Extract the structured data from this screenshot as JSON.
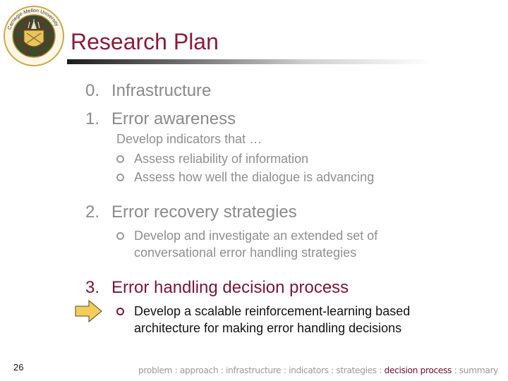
{
  "slide": {
    "title": "Research Plan",
    "logo_icon": "carnegie-mellon-university-seal",
    "colors": {
      "title": "#8b1a3a",
      "active": "#7a1535",
      "inactive_text": "#8a8a8a",
      "arrow_fill": "#f2cd5c"
    },
    "items": [
      {
        "number": "0.",
        "label": "Infrastructure"
      },
      {
        "number": "1.",
        "label": "Error awareness",
        "intro": "Develop indicators that …",
        "bullets": [
          "Assess reliability of information",
          "Assess how well the dialogue is advancing"
        ]
      },
      {
        "number": "2.",
        "label": "Error recovery strategies",
        "bullets": [
          "Develop and investigate an extended set of",
          "conversational error handling strategies"
        ]
      },
      {
        "number": "3.",
        "label": "Error handling decision process",
        "bullets": [
          "Develop a scalable reinforcement-learning based",
          "architecture for making error handling decisions"
        ]
      }
    ],
    "page_number": "26",
    "footer": {
      "before": "problem : approach : infrastructure : indicators : strategies : ",
      "current": "decision process",
      "after": " : summary"
    }
  }
}
